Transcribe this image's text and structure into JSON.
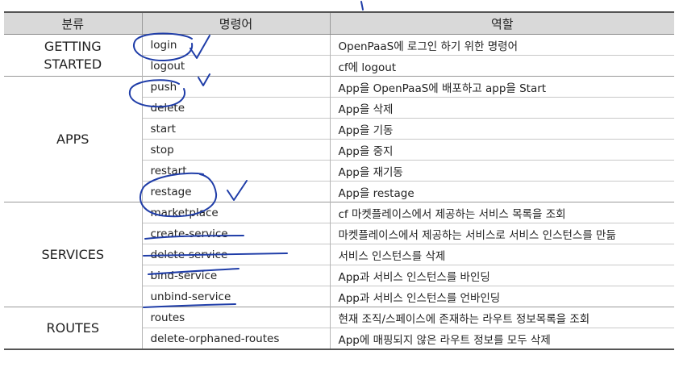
{
  "headers": [
    "분류",
    "명령어",
    "역할"
  ],
  "groups": [
    {
      "category": [
        "GETTING",
        "STARTED"
      ],
      "rows": [
        [
          "login",
          "OpenPaaS에 로그인 하기 위한 명령어"
        ],
        [
          "logout",
          "cf에 logout"
        ]
      ]
    },
    {
      "category": [
        "APPS"
      ],
      "rows": [
        [
          "push",
          "App을 OpenPaaS에 배포하고 app을 Start"
        ],
        [
          "delete",
          "App을 삭제"
        ],
        [
          "start",
          "App을 기동"
        ],
        [
          "stop",
          "App을 중지"
        ],
        [
          "restart",
          "App을 재기동"
        ],
        [
          "restage",
          "App을 restage"
        ]
      ]
    },
    {
      "category": [
        "SERVICES"
      ],
      "rows": [
        [
          "marketplace",
          "cf 마켓플레이스에서 제공하는 서비스 목록을 조회"
        ],
        [
          "create-service",
          "마켓플레이스에서 제공하는 서비스로 서비스 인스턴스를 만듦"
        ],
        [
          "delete-service",
          "서비스 인스턴스를 삭제"
        ],
        [
          "bind-service",
          "App과 서비스 인스턴스를 바인딩"
        ],
        [
          "unbind-service",
          "App과 서비스 인스턴스를 언바인딩"
        ]
      ]
    },
    {
      "category": [
        "ROUTES"
      ],
      "rows": [
        [
          "routes",
          "현재 조직/스페이스에 존재하는 라우트 정보목록을 조회"
        ],
        [
          "delete-orphaned-routes",
          "App에 매핑되지 않은 라우트 정보를 모두 삭제"
        ]
      ]
    }
  ],
  "colors": {
    "header_bg": "#d9d9d9",
    "annotation_ink": "#1f3da8"
  }
}
